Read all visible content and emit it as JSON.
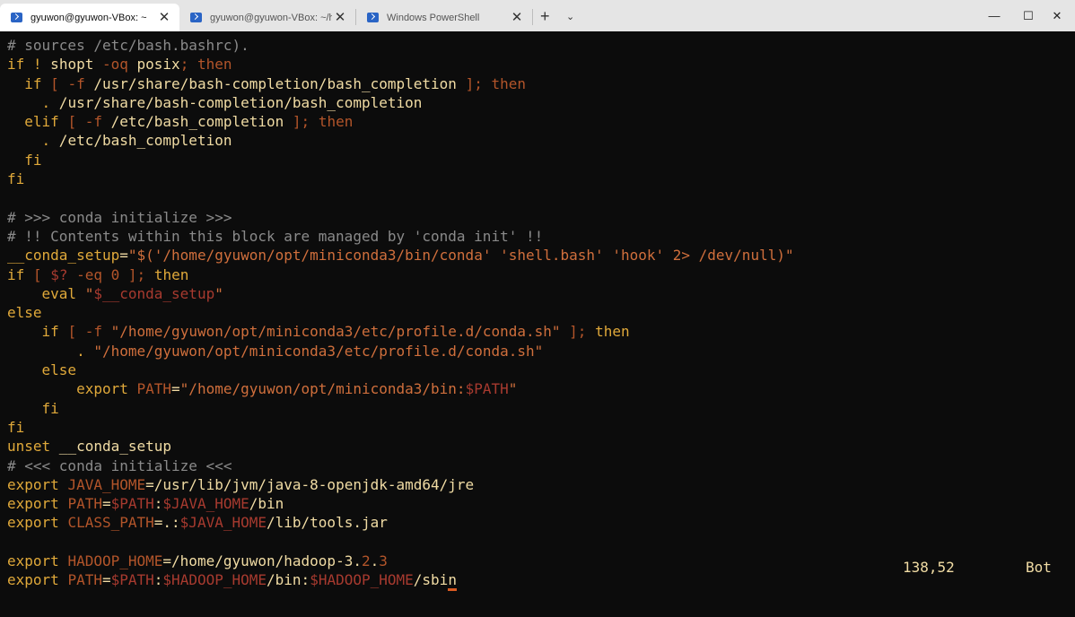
{
  "tabs": [
    {
      "label": "gyuwon@gyuwon-VBox: ~",
      "active": true
    },
    {
      "label": "gyuwon@gyuwon-VBox: ~/ha",
      "active": false
    },
    {
      "label": "Windows PowerShell",
      "active": false
    }
  ],
  "tab_close_glyph": "✕",
  "new_tab_glyph": "+",
  "dropdown_glyph": "⌄",
  "window_controls": {
    "minimize": "—",
    "maximize": "☐",
    "close": "✕"
  },
  "status": {
    "position": "138,52",
    "scroll": "Bot"
  },
  "icons": {
    "tab_icon": "powershell-icon"
  },
  "colors": {
    "background": "#0c0c0c",
    "keyword": "#e0a93a",
    "comment": "#8a8a8a",
    "string": "#d06f3c",
    "text": "#f1dca4",
    "cursor": "#d95a21"
  },
  "lines": [
    [
      {
        "c": "c",
        "t": "# sources /etc/bash.bashrc)."
      }
    ],
    [
      {
        "c": "k",
        "t": "if"
      },
      {
        "c": "t",
        "t": " "
      },
      {
        "c": "k",
        "t": "!"
      },
      {
        "c": "t",
        "t": " shopt "
      },
      {
        "c": "br",
        "t": "-oq"
      },
      {
        "c": "t",
        "t": " posix"
      },
      {
        "c": "br",
        "t": ";"
      },
      {
        "c": "t",
        "t": " "
      },
      {
        "c": "br",
        "t": "then"
      }
    ],
    [
      {
        "c": "t",
        "t": "  "
      },
      {
        "c": "k",
        "t": "if"
      },
      {
        "c": "t",
        "t": " "
      },
      {
        "c": "br",
        "t": "["
      },
      {
        "c": "t",
        "t": " "
      },
      {
        "c": "br",
        "t": "-f"
      },
      {
        "c": "t",
        "t": " /usr/share/bash-completion/bash_completion "
      },
      {
        "c": "br",
        "t": "];"
      },
      {
        "c": "t",
        "t": " "
      },
      {
        "c": "br",
        "t": "then"
      }
    ],
    [
      {
        "c": "t",
        "t": "    "
      },
      {
        "c": "k",
        "t": "."
      },
      {
        "c": "t",
        "t": " /usr/share/bash-completion/bash_completion"
      }
    ],
    [
      {
        "c": "t",
        "t": "  "
      },
      {
        "c": "k",
        "t": "elif"
      },
      {
        "c": "t",
        "t": " "
      },
      {
        "c": "br",
        "t": "["
      },
      {
        "c": "t",
        "t": " "
      },
      {
        "c": "br",
        "t": "-f"
      },
      {
        "c": "t",
        "t": " /etc/bash_completion "
      },
      {
        "c": "br",
        "t": "];"
      },
      {
        "c": "t",
        "t": " "
      },
      {
        "c": "br",
        "t": "then"
      }
    ],
    [
      {
        "c": "t",
        "t": "    "
      },
      {
        "c": "k",
        "t": "."
      },
      {
        "c": "t",
        "t": " /etc/bash_completion"
      }
    ],
    [
      {
        "c": "t",
        "t": "  "
      },
      {
        "c": "k",
        "t": "fi"
      }
    ],
    [
      {
        "c": "k",
        "t": "fi"
      }
    ],
    [
      {
        "c": "t",
        "t": ""
      }
    ],
    [
      {
        "c": "c",
        "t": "# >>> conda initialize >>>"
      }
    ],
    [
      {
        "c": "c",
        "t": "# !! Contents within this block are managed by 'conda init' !!"
      }
    ],
    [
      {
        "c": "k",
        "t": "__conda_setup"
      },
      {
        "c": "t",
        "t": "="
      },
      {
        "c": "s",
        "t": "\"$('/home/gyuwon/opt/miniconda3/bin/conda' 'shell.bash' 'hook' 2> /dev/null)\""
      }
    ],
    [
      {
        "c": "k",
        "t": "if"
      },
      {
        "c": "t",
        "t": " "
      },
      {
        "c": "br",
        "t": "["
      },
      {
        "c": "t",
        "t": " "
      },
      {
        "c": "v",
        "t": "$?"
      },
      {
        "c": "t",
        "t": " "
      },
      {
        "c": "br",
        "t": "-eq"
      },
      {
        "c": "t",
        "t": " "
      },
      {
        "c": "n",
        "t": "0"
      },
      {
        "c": "t",
        "t": " "
      },
      {
        "c": "br",
        "t": "];"
      },
      {
        "c": "t",
        "t": " "
      },
      {
        "c": "k",
        "t": "then"
      }
    ],
    [
      {
        "c": "t",
        "t": "    "
      },
      {
        "c": "k",
        "t": "eval"
      },
      {
        "c": "t",
        "t": " "
      },
      {
        "c": "s",
        "t": "\""
      },
      {
        "c": "v",
        "t": "$__conda_setup"
      },
      {
        "c": "s",
        "t": "\""
      }
    ],
    [
      {
        "c": "k",
        "t": "else"
      }
    ],
    [
      {
        "c": "t",
        "t": "    "
      },
      {
        "c": "k",
        "t": "if"
      },
      {
        "c": "t",
        "t": " "
      },
      {
        "c": "br",
        "t": "["
      },
      {
        "c": "t",
        "t": " "
      },
      {
        "c": "br",
        "t": "-f"
      },
      {
        "c": "t",
        "t": " "
      },
      {
        "c": "s",
        "t": "\"/home/gyuwon/opt/miniconda3/etc/profile.d/conda.sh\""
      },
      {
        "c": "t",
        "t": " "
      },
      {
        "c": "br",
        "t": "];"
      },
      {
        "c": "t",
        "t": " "
      },
      {
        "c": "k",
        "t": "then"
      }
    ],
    [
      {
        "c": "t",
        "t": "        "
      },
      {
        "c": "k",
        "t": "."
      },
      {
        "c": "t",
        "t": " "
      },
      {
        "c": "s",
        "t": "\"/home/gyuwon/opt/miniconda3/etc/profile.d/conda.sh\""
      }
    ],
    [
      {
        "c": "t",
        "t": "    "
      },
      {
        "c": "k",
        "t": "else"
      }
    ],
    [
      {
        "c": "t",
        "t": "        "
      },
      {
        "c": "k",
        "t": "export"
      },
      {
        "c": "t",
        "t": " "
      },
      {
        "c": "br",
        "t": "PATH"
      },
      {
        "c": "t",
        "t": "="
      },
      {
        "c": "s",
        "t": "\"/home/gyuwon/opt/miniconda3/bin:"
      },
      {
        "c": "v",
        "t": "$PATH"
      },
      {
        "c": "s",
        "t": "\""
      }
    ],
    [
      {
        "c": "t",
        "t": "    "
      },
      {
        "c": "k",
        "t": "fi"
      }
    ],
    [
      {
        "c": "k",
        "t": "fi"
      }
    ],
    [
      {
        "c": "k",
        "t": "unset"
      },
      {
        "c": "t",
        "t": " __conda_setup"
      }
    ],
    [
      {
        "c": "c",
        "t": "# <<< conda initialize <<<"
      }
    ],
    [
      {
        "c": "k",
        "t": "export"
      },
      {
        "c": "t",
        "t": " "
      },
      {
        "c": "br",
        "t": "JAVA_HOME"
      },
      {
        "c": "t",
        "t": "=/usr/lib/jvm/java-8-openjdk-amd64/jre"
      }
    ],
    [
      {
        "c": "k",
        "t": "export"
      },
      {
        "c": "t",
        "t": " "
      },
      {
        "c": "br",
        "t": "PATH"
      },
      {
        "c": "t",
        "t": "="
      },
      {
        "c": "v",
        "t": "$PATH"
      },
      {
        "c": "t",
        "t": ":"
      },
      {
        "c": "v",
        "t": "$JAVA_HOME"
      },
      {
        "c": "t",
        "t": "/bin"
      }
    ],
    [
      {
        "c": "k",
        "t": "export"
      },
      {
        "c": "t",
        "t": " "
      },
      {
        "c": "br",
        "t": "CLASS_PATH"
      },
      {
        "c": "t",
        "t": "=.:"
      },
      {
        "c": "v",
        "t": "$JAVA_HOME"
      },
      {
        "c": "t",
        "t": "/lib/tools.jar"
      }
    ],
    [
      {
        "c": "t",
        "t": ""
      }
    ],
    [
      {
        "c": "k",
        "t": "export"
      },
      {
        "c": "t",
        "t": " "
      },
      {
        "c": "br",
        "t": "HADOOP_HOME"
      },
      {
        "c": "t",
        "t": "=/home/gyuwon/hadoop-3."
      },
      {
        "c": "n",
        "t": "2"
      },
      {
        "c": "t",
        "t": "."
      },
      {
        "c": "n",
        "t": "3"
      }
    ],
    [
      {
        "c": "k",
        "t": "export"
      },
      {
        "c": "t",
        "t": " "
      },
      {
        "c": "br",
        "t": "PATH"
      },
      {
        "c": "t",
        "t": "="
      },
      {
        "c": "v",
        "t": "$PATH"
      },
      {
        "c": "t",
        "t": ":"
      },
      {
        "c": "v",
        "t": "$HADOOP_HOME"
      },
      {
        "c": "t",
        "t": "/bin:"
      },
      {
        "c": "v",
        "t": "$HADOOP_HOME"
      },
      {
        "c": "t",
        "t": "/sbi"
      },
      {
        "c": "t",
        "t": "n",
        "cursor": true
      }
    ]
  ]
}
